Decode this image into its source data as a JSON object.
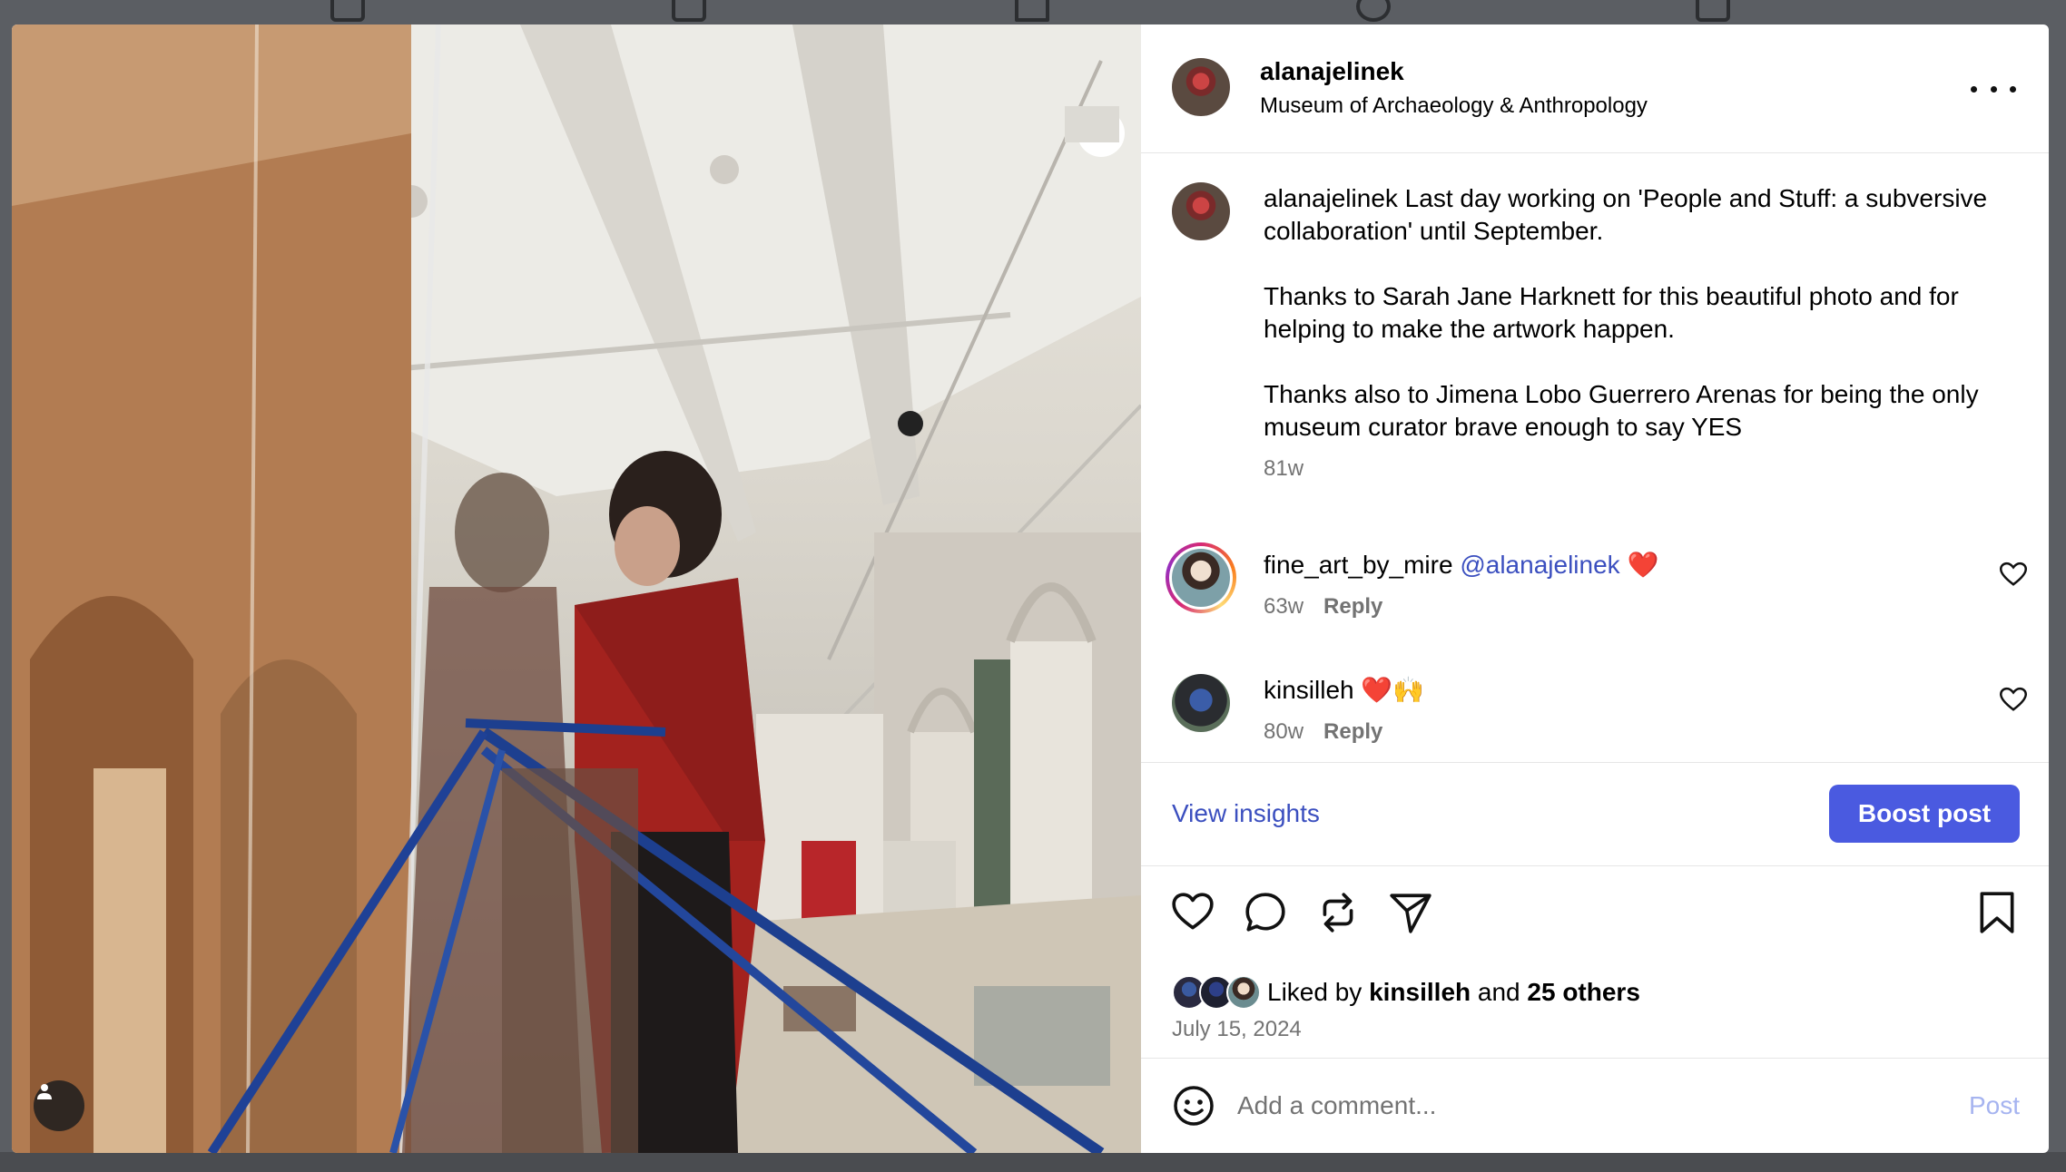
{
  "post": {
    "username": "alanajelinek",
    "location": "Museum of Archaeology & Anthropology",
    "caption": {
      "author": "alanajelinek",
      "line1": "Last day working on 'People and Stuff: a subversive collaboration' until September.",
      "para2": "Thanks to Sarah Jane Harknett for this beautiful photo and for helping to make the artwork happen.",
      "para3": "Thanks also to Jimena Lobo Guerrero Arenas for being the only museum curator brave enough to say YES",
      "time": "81w"
    },
    "comments": [
      {
        "username": "fine_art_by_mire",
        "mention": "@alanajelinek",
        "emoji": "❤️",
        "time": "63w",
        "reply_label": "Reply"
      },
      {
        "username": "kinsilleh",
        "mention": "",
        "emoji": "❤️🙌",
        "time": "80w",
        "reply_label": "Reply"
      }
    ],
    "insights_label": "View insights",
    "boost_label": "Boost post",
    "likes": {
      "prefix": "Liked by",
      "user": "kinsilleh",
      "conjunction": "and",
      "others": "25 others"
    },
    "date": "July 15, 2024",
    "comment_input": {
      "placeholder": "Add a comment...",
      "value": ""
    },
    "post_button_label": "Post"
  },
  "icons": {
    "more": "more-horizontal-icon",
    "like": "heart-icon",
    "comment": "comment-bubble-icon",
    "repost": "repost-icon",
    "share": "send-icon",
    "save": "bookmark-icon",
    "emoji": "emoji-icon",
    "user_tag": "user-tag-icon"
  },
  "colors": {
    "accent": "#4a5ae0",
    "link": "#3b4fbf",
    "muted": "#737373",
    "post_disabled": "#a6b4f0"
  }
}
